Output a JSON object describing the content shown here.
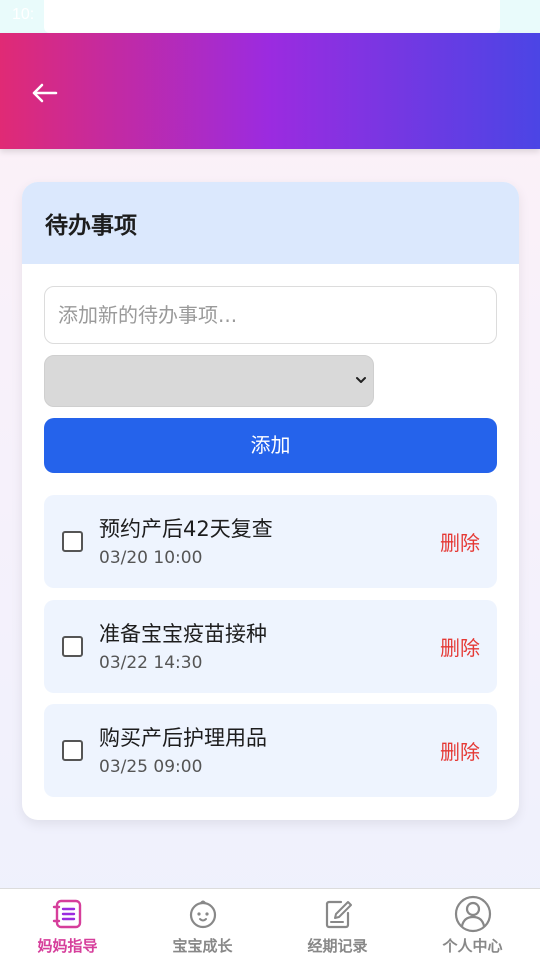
{
  "status": {
    "time": "10:"
  },
  "header": {
    "back_icon": "arrow-left-icon"
  },
  "todo": {
    "title": "待办事项",
    "input_placeholder": "添加新的待办事项...",
    "select_value": "",
    "add_label": "添加",
    "items": [
      {
        "text": "预约产后42天复查",
        "time": "03/20 10:00",
        "delete_label": "删除"
      },
      {
        "text": "准备宝宝疫苗接种",
        "time": "03/22 14:30",
        "delete_label": "删除"
      },
      {
        "text": "购买产后护理用品",
        "time": "03/25 09:00",
        "delete_label": "删除"
      }
    ]
  },
  "tabs": [
    {
      "label": "妈妈指导",
      "icon": "guide-icon",
      "active": true
    },
    {
      "label": "宝宝成长",
      "icon": "baby-face-icon",
      "active": false
    },
    {
      "label": "经期记录",
      "icon": "edit-note-icon",
      "active": false
    },
    {
      "label": "个人中心",
      "icon": "user-icon",
      "active": false
    }
  ],
  "colors": {
    "accent": "#2563eb",
    "delete": "#e53935",
    "active_tab": "#d63e9b",
    "header_start": "#e02a75",
    "header_end": "#4b45e5"
  }
}
